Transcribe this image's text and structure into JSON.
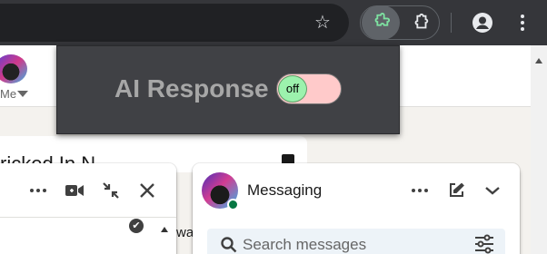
{
  "browser": {
    "icons": {
      "bookmark": "star-icon",
      "active_extension": "puzzle-piece-icon",
      "extensions_menu": "extensions-icon",
      "profile": "profile-icon",
      "menu": "kebab-menu-icon"
    },
    "colors": {
      "bar": "#35363a",
      "omnibox": "#202124",
      "extension_accent": "#7ee2a1"
    }
  },
  "linkedin": {
    "nav": {
      "me_label": "Me"
    },
    "card": {
      "heading_visible": "ricked In N"
    },
    "chat_window": {
      "icons": [
        "more-options-icon",
        "video-call-icon",
        "collapse-icon",
        "close-icon"
      ],
      "overflow_text": "wa"
    },
    "messaging": {
      "title": "Messaging",
      "search": {
        "placeholder": "Search messages"
      },
      "status": "online",
      "colors": {
        "online": "#057642",
        "search_bg": "#edf3f8"
      }
    }
  },
  "extension_popup": {
    "title": "AI Response",
    "toggle": {
      "state_label": "off",
      "checked": false
    },
    "colors": {
      "panel": "#404145",
      "title": "#a7a7a7",
      "toggle_track": "#ffcaca",
      "toggle_knob": "#9cf2ad"
    }
  }
}
